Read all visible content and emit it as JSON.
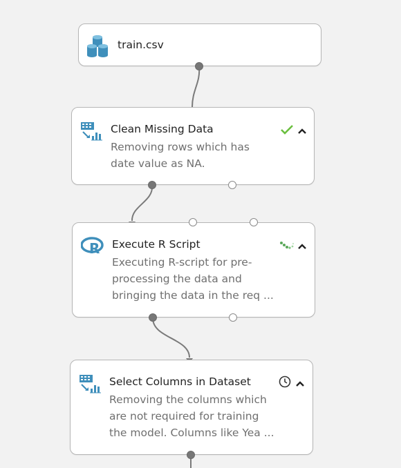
{
  "nodes": {
    "train": {
      "title": "train.csv",
      "icon": "dataset-icon"
    },
    "clean": {
      "title": "Clean Missing Data",
      "desc": [
        "Removing rows which has",
        "date value as NA."
      ],
      "icon": "data-transform-icon",
      "status": "success-check-icon"
    },
    "rscript": {
      "title": "Execute R Script",
      "desc": [
        "Executing R-script for pre-",
        "processing the data and",
        "bringing the data in the req ..."
      ],
      "icon": "r-language-icon",
      "status": "running-spinner-icon"
    },
    "select": {
      "title": "Select Columns in Dataset",
      "desc": [
        "Removing the columns which",
        "are not required for training",
        "the model. Columns like Yea ..."
      ],
      "icon": "data-transform-icon",
      "status": "queued-clock-icon"
    }
  },
  "colors": {
    "icon_blue": "#3f8fbb",
    "success_green": "#6bbf3f",
    "spinner_green": "#5aa85a",
    "connector": "#7a7a7a"
  }
}
